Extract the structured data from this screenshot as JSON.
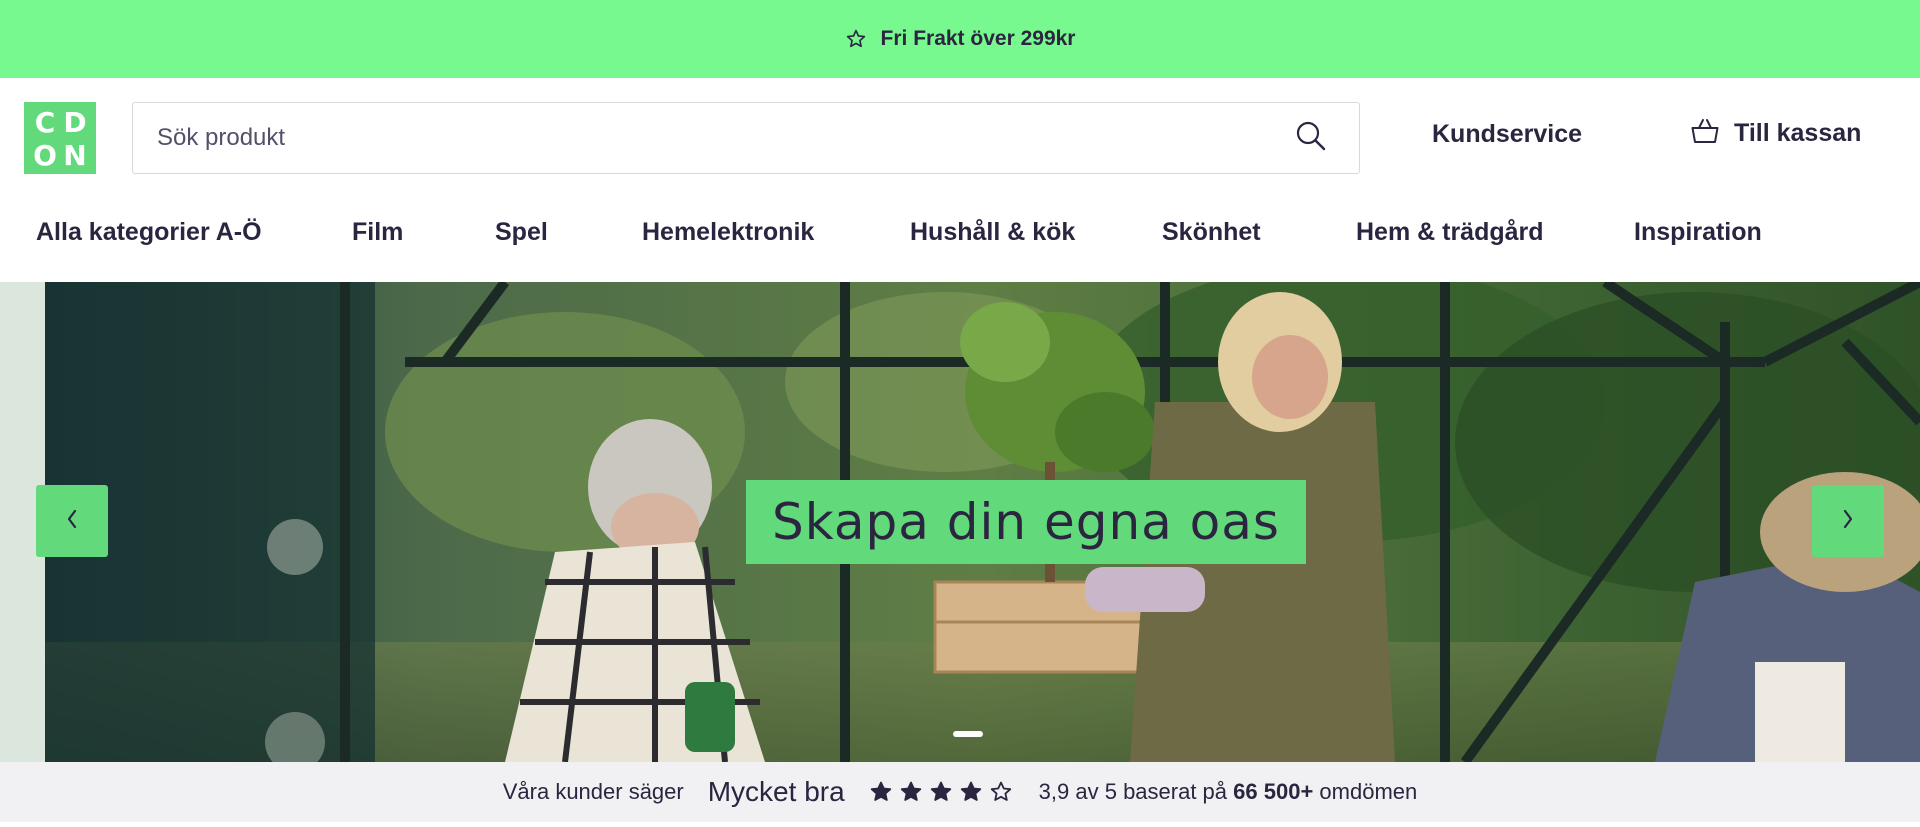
{
  "promo": {
    "text": "Fri Frakt över 299kr",
    "icon": "star-outline-icon"
  },
  "logo": {
    "letters": [
      "C",
      "D",
      "O",
      "N"
    ],
    "color": "#62da7b"
  },
  "search": {
    "placeholder": "Sök produkt",
    "value": "",
    "icon": "search-icon"
  },
  "header": {
    "customer_service": "Kundservice",
    "cart_label": "Till kassan",
    "cart_icon": "basket-icon"
  },
  "nav": {
    "items": [
      {
        "label": "Alla kategorier A-Ö"
      },
      {
        "label": "Film"
      },
      {
        "label": "Spel"
      },
      {
        "label": "Hemelektronik"
      },
      {
        "label": "Hushåll & kök"
      },
      {
        "label": "Skönhet"
      },
      {
        "label": "Hem & trädgård"
      },
      {
        "label": "Inspiration"
      }
    ]
  },
  "hero": {
    "headline": "Skapa din egna oas",
    "prev_symbol": "‹",
    "next_symbol": "›",
    "active_slide": 1,
    "slide_count": 1
  },
  "rating": {
    "intro": "Våra kunder säger",
    "word": "Mycket bra",
    "stars_filled": 4,
    "stars_total": 5,
    "summary_prefix": "3,9 av 5 baserat på",
    "summary_count": "66 500+",
    "summary_suffix": "omdömen"
  },
  "colors": {
    "promo_bg": "#78f98f",
    "accent": "#62da7b",
    "text": "#2b2540",
    "rating_bg": "#f1f1f3"
  }
}
